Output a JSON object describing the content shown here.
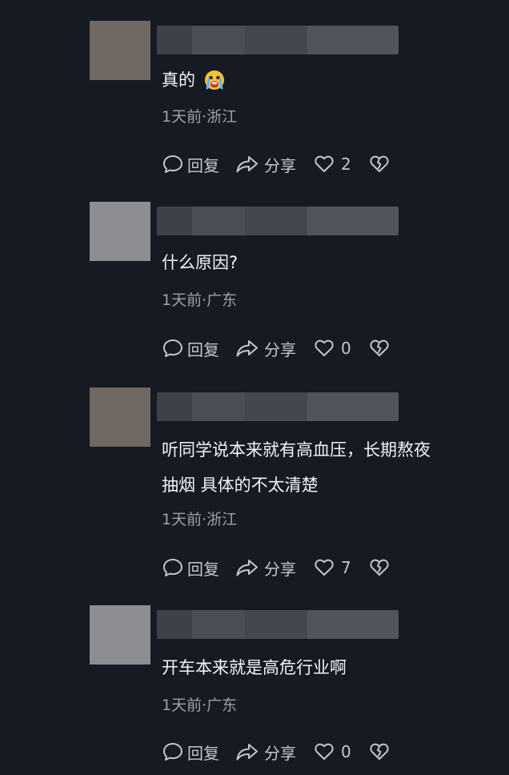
{
  "actions": {
    "reply_label": "回复",
    "share_label": "分享"
  },
  "comments": [
    {
      "text": "真的",
      "emoji": "crying-face-icon",
      "meta": "1天前·浙江",
      "likes": "2",
      "avatar_color": "#6f6863"
    },
    {
      "text": "什么原因?",
      "meta": "1天前·广东",
      "likes": "0",
      "avatar_color": "#8c8e92"
    },
    {
      "text_line1": "听同学说本来就有高血压，长期熬夜",
      "text_line2": "抽烟  具体的不太清楚",
      "meta": "1天前·浙江",
      "likes": "7",
      "avatar_color": "#6f6863"
    },
    {
      "text": "开车本来就是高危行业啊",
      "meta": "1天前·广东",
      "likes": "0",
      "avatar_color": "#8c8e92"
    }
  ]
}
